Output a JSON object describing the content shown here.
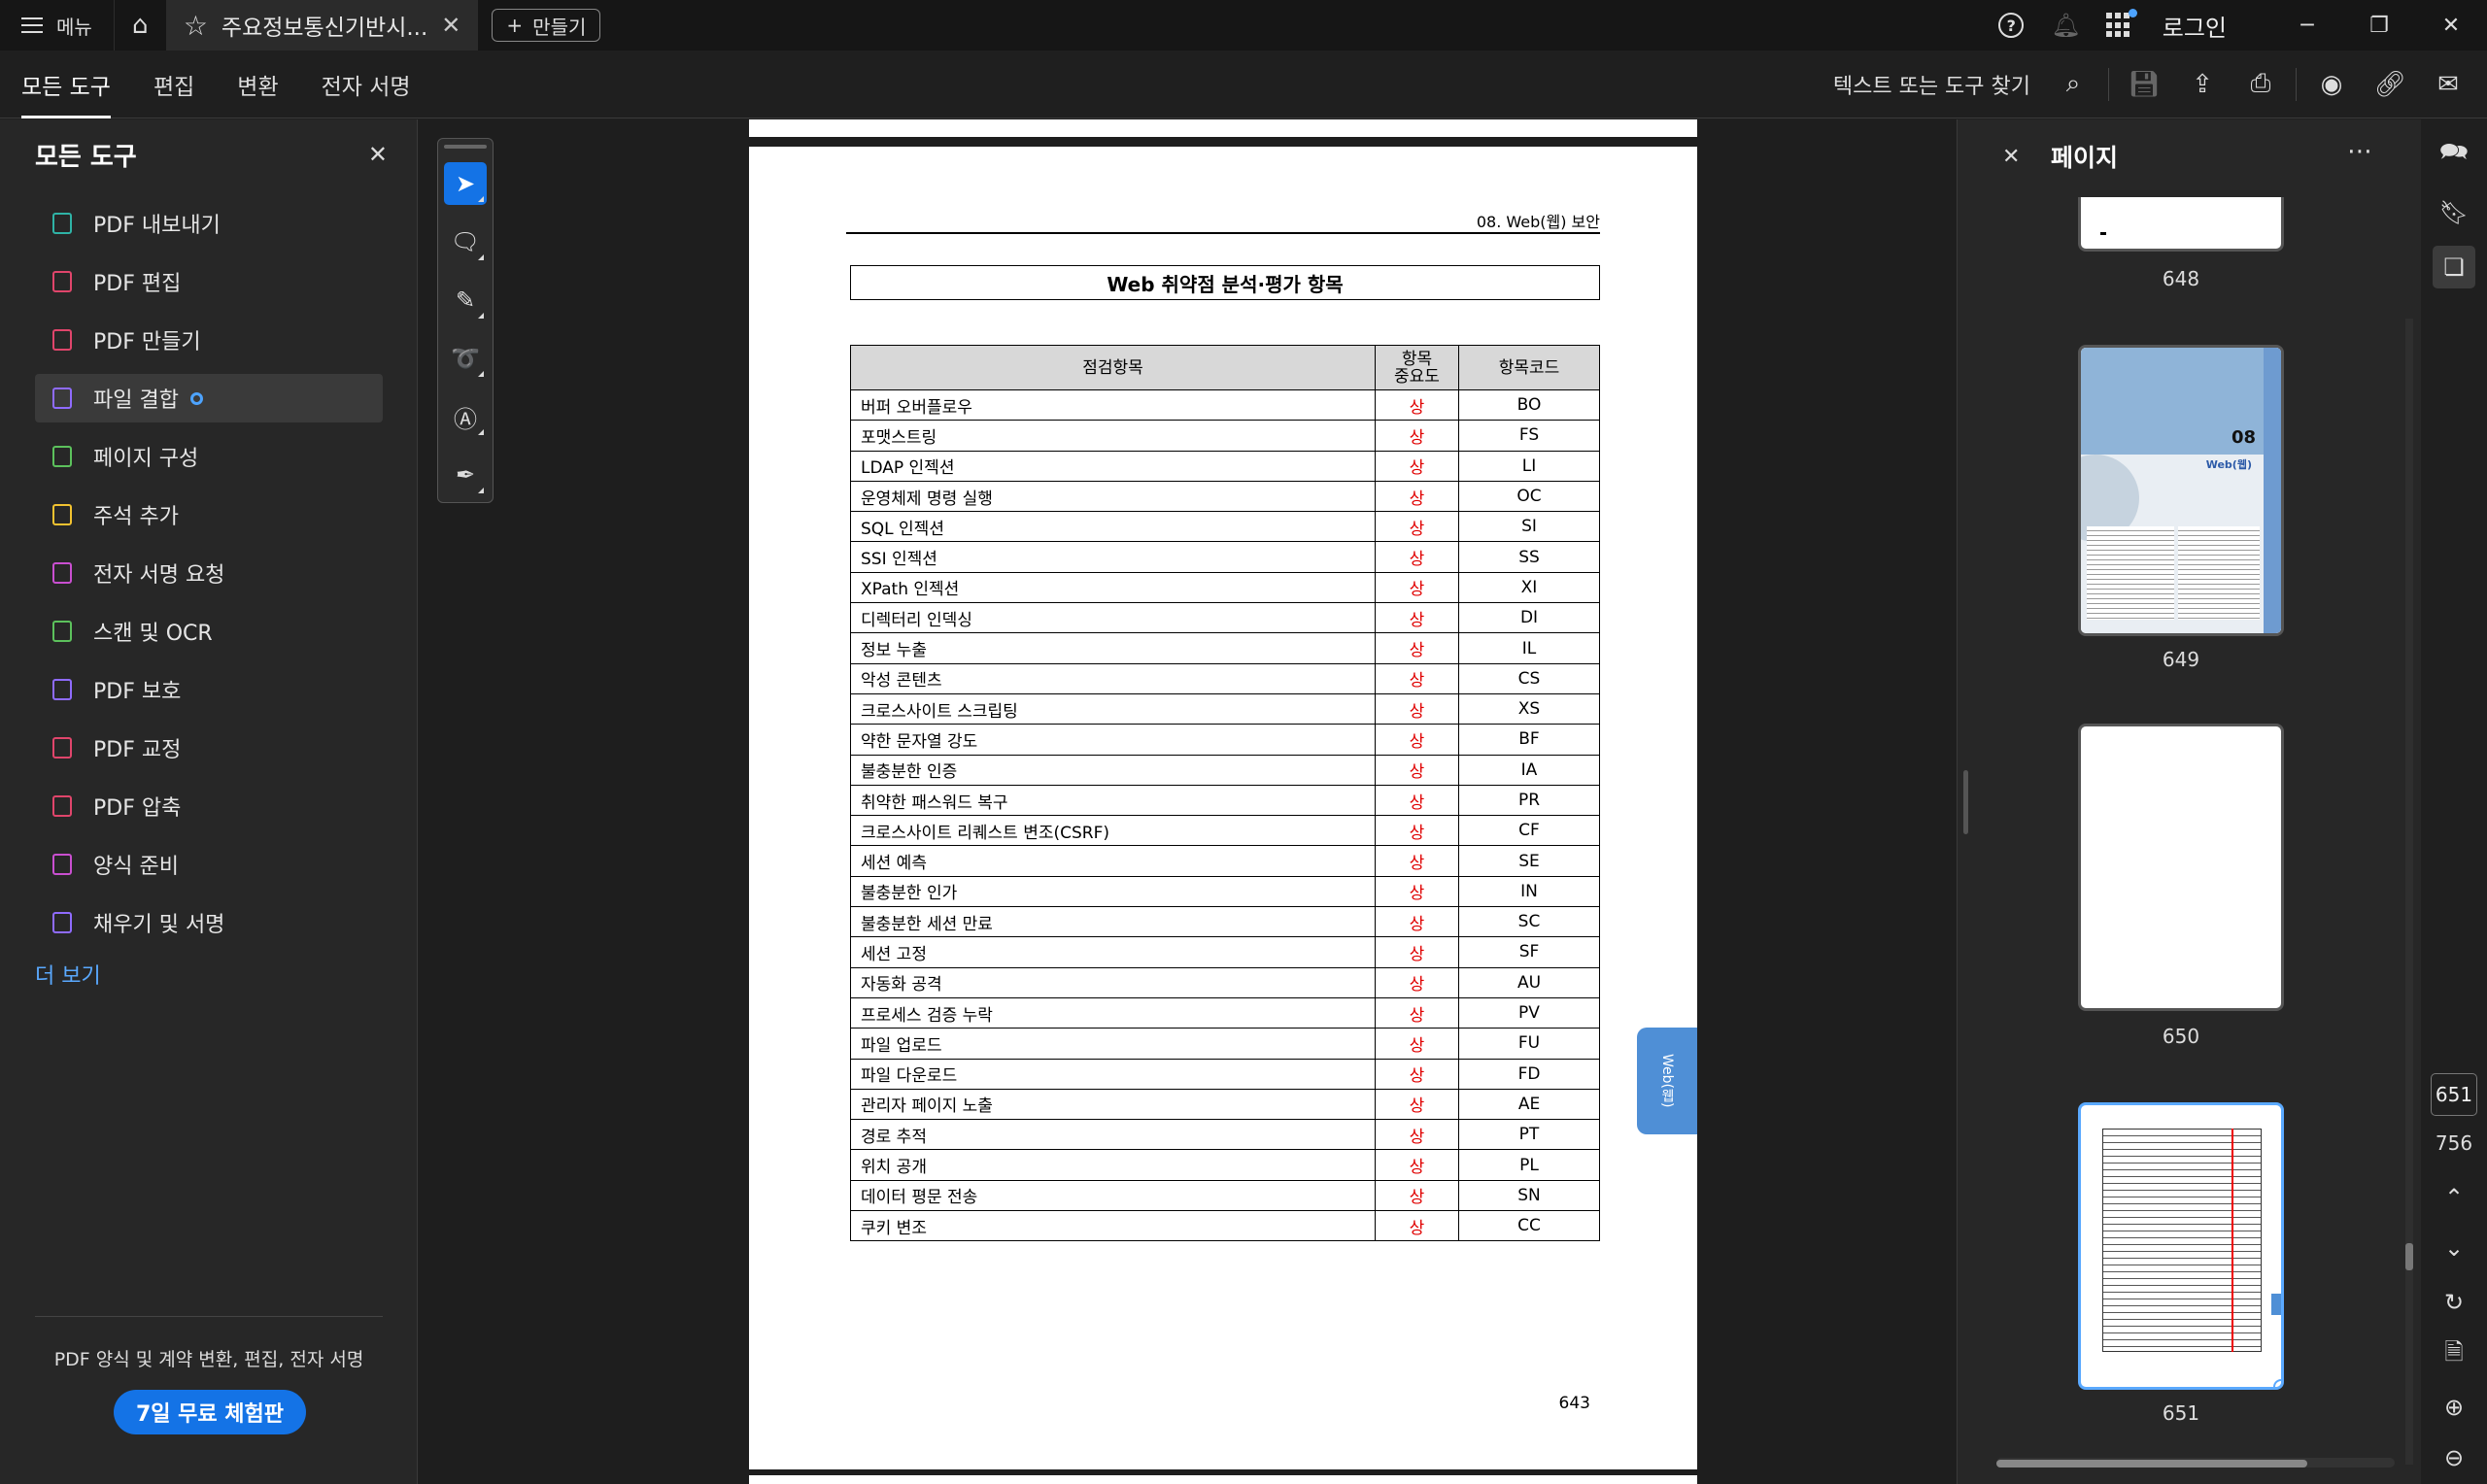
{
  "titlebar": {
    "menu_label": "메뉴",
    "tab_title": "주요정보통신기반시...",
    "new_label": "만들기",
    "login_label": "로그인"
  },
  "toolbar": {
    "tabs": [
      "모든 도구",
      "편집",
      "변환",
      "전자 서명"
    ],
    "find_label": "텍스트 또는 도구 찾기"
  },
  "left_panel": {
    "title": "모든 도구",
    "items": [
      {
        "label": "PDF 내보내기",
        "icon": "export-icon",
        "color": "#2fb3a6"
      },
      {
        "label": "PDF 편집",
        "icon": "edit-icon",
        "color": "#e0456b"
      },
      {
        "label": "PDF 만들기",
        "icon": "create-icon",
        "color": "#e0456b"
      },
      {
        "label": "파일 결합",
        "icon": "combine-icon",
        "color": "#8f6bff"
      },
      {
        "label": "페이지 구성",
        "icon": "organize-icon",
        "color": "#5cc15c"
      },
      {
        "label": "주석 추가",
        "icon": "comment-icon",
        "color": "#f2c230"
      },
      {
        "label": "전자 서명 요청",
        "icon": "request-sign-icon",
        "color": "#c94fd0"
      },
      {
        "label": "스캔 및 OCR",
        "icon": "scan-icon",
        "color": "#5cc15c"
      },
      {
        "label": "PDF 보호",
        "icon": "protect-icon",
        "color": "#8f6bff"
      },
      {
        "label": "PDF 교정",
        "icon": "redact-icon",
        "color": "#e0456b"
      },
      {
        "label": "PDF 압축",
        "icon": "compress-icon",
        "color": "#e0456b"
      },
      {
        "label": "양식 준비",
        "icon": "form-icon",
        "color": "#c94fd0"
      },
      {
        "label": "채우기 및 서명",
        "icon": "fill-sign-icon",
        "color": "#8f6bff"
      }
    ],
    "more_label": "더 보기",
    "promo_text": "PDF 양식 및 계약 변환, 편집, 전자 서명",
    "trial_label": "7일 무료 체험판"
  },
  "document": {
    "header_text": "08. Web(웹) 보안",
    "page_title": "Web 취약점 분석·평가 항목",
    "col_item": "점검항목",
    "col_importance": "항목\n중요도",
    "col_code": "항목코드",
    "rows": [
      {
        "item": "버퍼 오버플로우",
        "imp": "상",
        "code": "BO"
      },
      {
        "item": "포맷스트링",
        "imp": "상",
        "code": "FS"
      },
      {
        "item": "LDAP 인젝션",
        "imp": "상",
        "code": "LI"
      },
      {
        "item": "운영체제 명령 실행",
        "imp": "상",
        "code": "OC"
      },
      {
        "item": "SQL 인젝션",
        "imp": "상",
        "code": "SI"
      },
      {
        "item": "SSI 인젝션",
        "imp": "상",
        "code": "SS"
      },
      {
        "item": "XPath 인젝션",
        "imp": "상",
        "code": "XI"
      },
      {
        "item": "디렉터리 인덱싱",
        "imp": "상",
        "code": "DI"
      },
      {
        "item": "정보 누출",
        "imp": "상",
        "code": "IL"
      },
      {
        "item": "악성 콘텐츠",
        "imp": "상",
        "code": "CS"
      },
      {
        "item": "크로스사이트 스크립팅",
        "imp": "상",
        "code": "XS"
      },
      {
        "item": "약한 문자열 강도",
        "imp": "상",
        "code": "BF"
      },
      {
        "item": "불충분한 인증",
        "imp": "상",
        "code": "IA"
      },
      {
        "item": "취약한 패스워드 복구",
        "imp": "상",
        "code": "PR"
      },
      {
        "item": "크로스사이트 리퀘스트 변조(CSRF)",
        "imp": "상",
        "code": "CF"
      },
      {
        "item": "세션 예측",
        "imp": "상",
        "code": "SE"
      },
      {
        "item": "불충분한 인가",
        "imp": "상",
        "code": "IN"
      },
      {
        "item": "불충분한 세션 만료",
        "imp": "상",
        "code": "SC"
      },
      {
        "item": "세션 고정",
        "imp": "상",
        "code": "SF"
      },
      {
        "item": "자동화 공격",
        "imp": "상",
        "code": "AU"
      },
      {
        "item": "프로세스 검증 누락",
        "imp": "상",
        "code": "PV"
      },
      {
        "item": "파일 업로드",
        "imp": "상",
        "code": "FU"
      },
      {
        "item": "파일 다운로드",
        "imp": "상",
        "code": "FD"
      },
      {
        "item": "관리자 페이지 노출",
        "imp": "상",
        "code": "AE"
      },
      {
        "item": "경로 추적",
        "imp": "상",
        "code": "PT"
      },
      {
        "item": "위치 공개",
        "imp": "상",
        "code": "PL"
      },
      {
        "item": "데이터 평문 전송",
        "imp": "상",
        "code": "SN"
      },
      {
        "item": "쿠키 변조",
        "imp": "상",
        "code": "CC"
      }
    ],
    "page_number": "643",
    "side_tab": "Web(웹)"
  },
  "pages_panel": {
    "title": "페이지",
    "thumbnails": [
      "648",
      "649",
      "650",
      "651"
    ],
    "thumb649_chapter": "08",
    "thumb649_title": "Web(웹)"
  },
  "right_rail": {
    "current_page": "651",
    "total_pages": "756"
  }
}
